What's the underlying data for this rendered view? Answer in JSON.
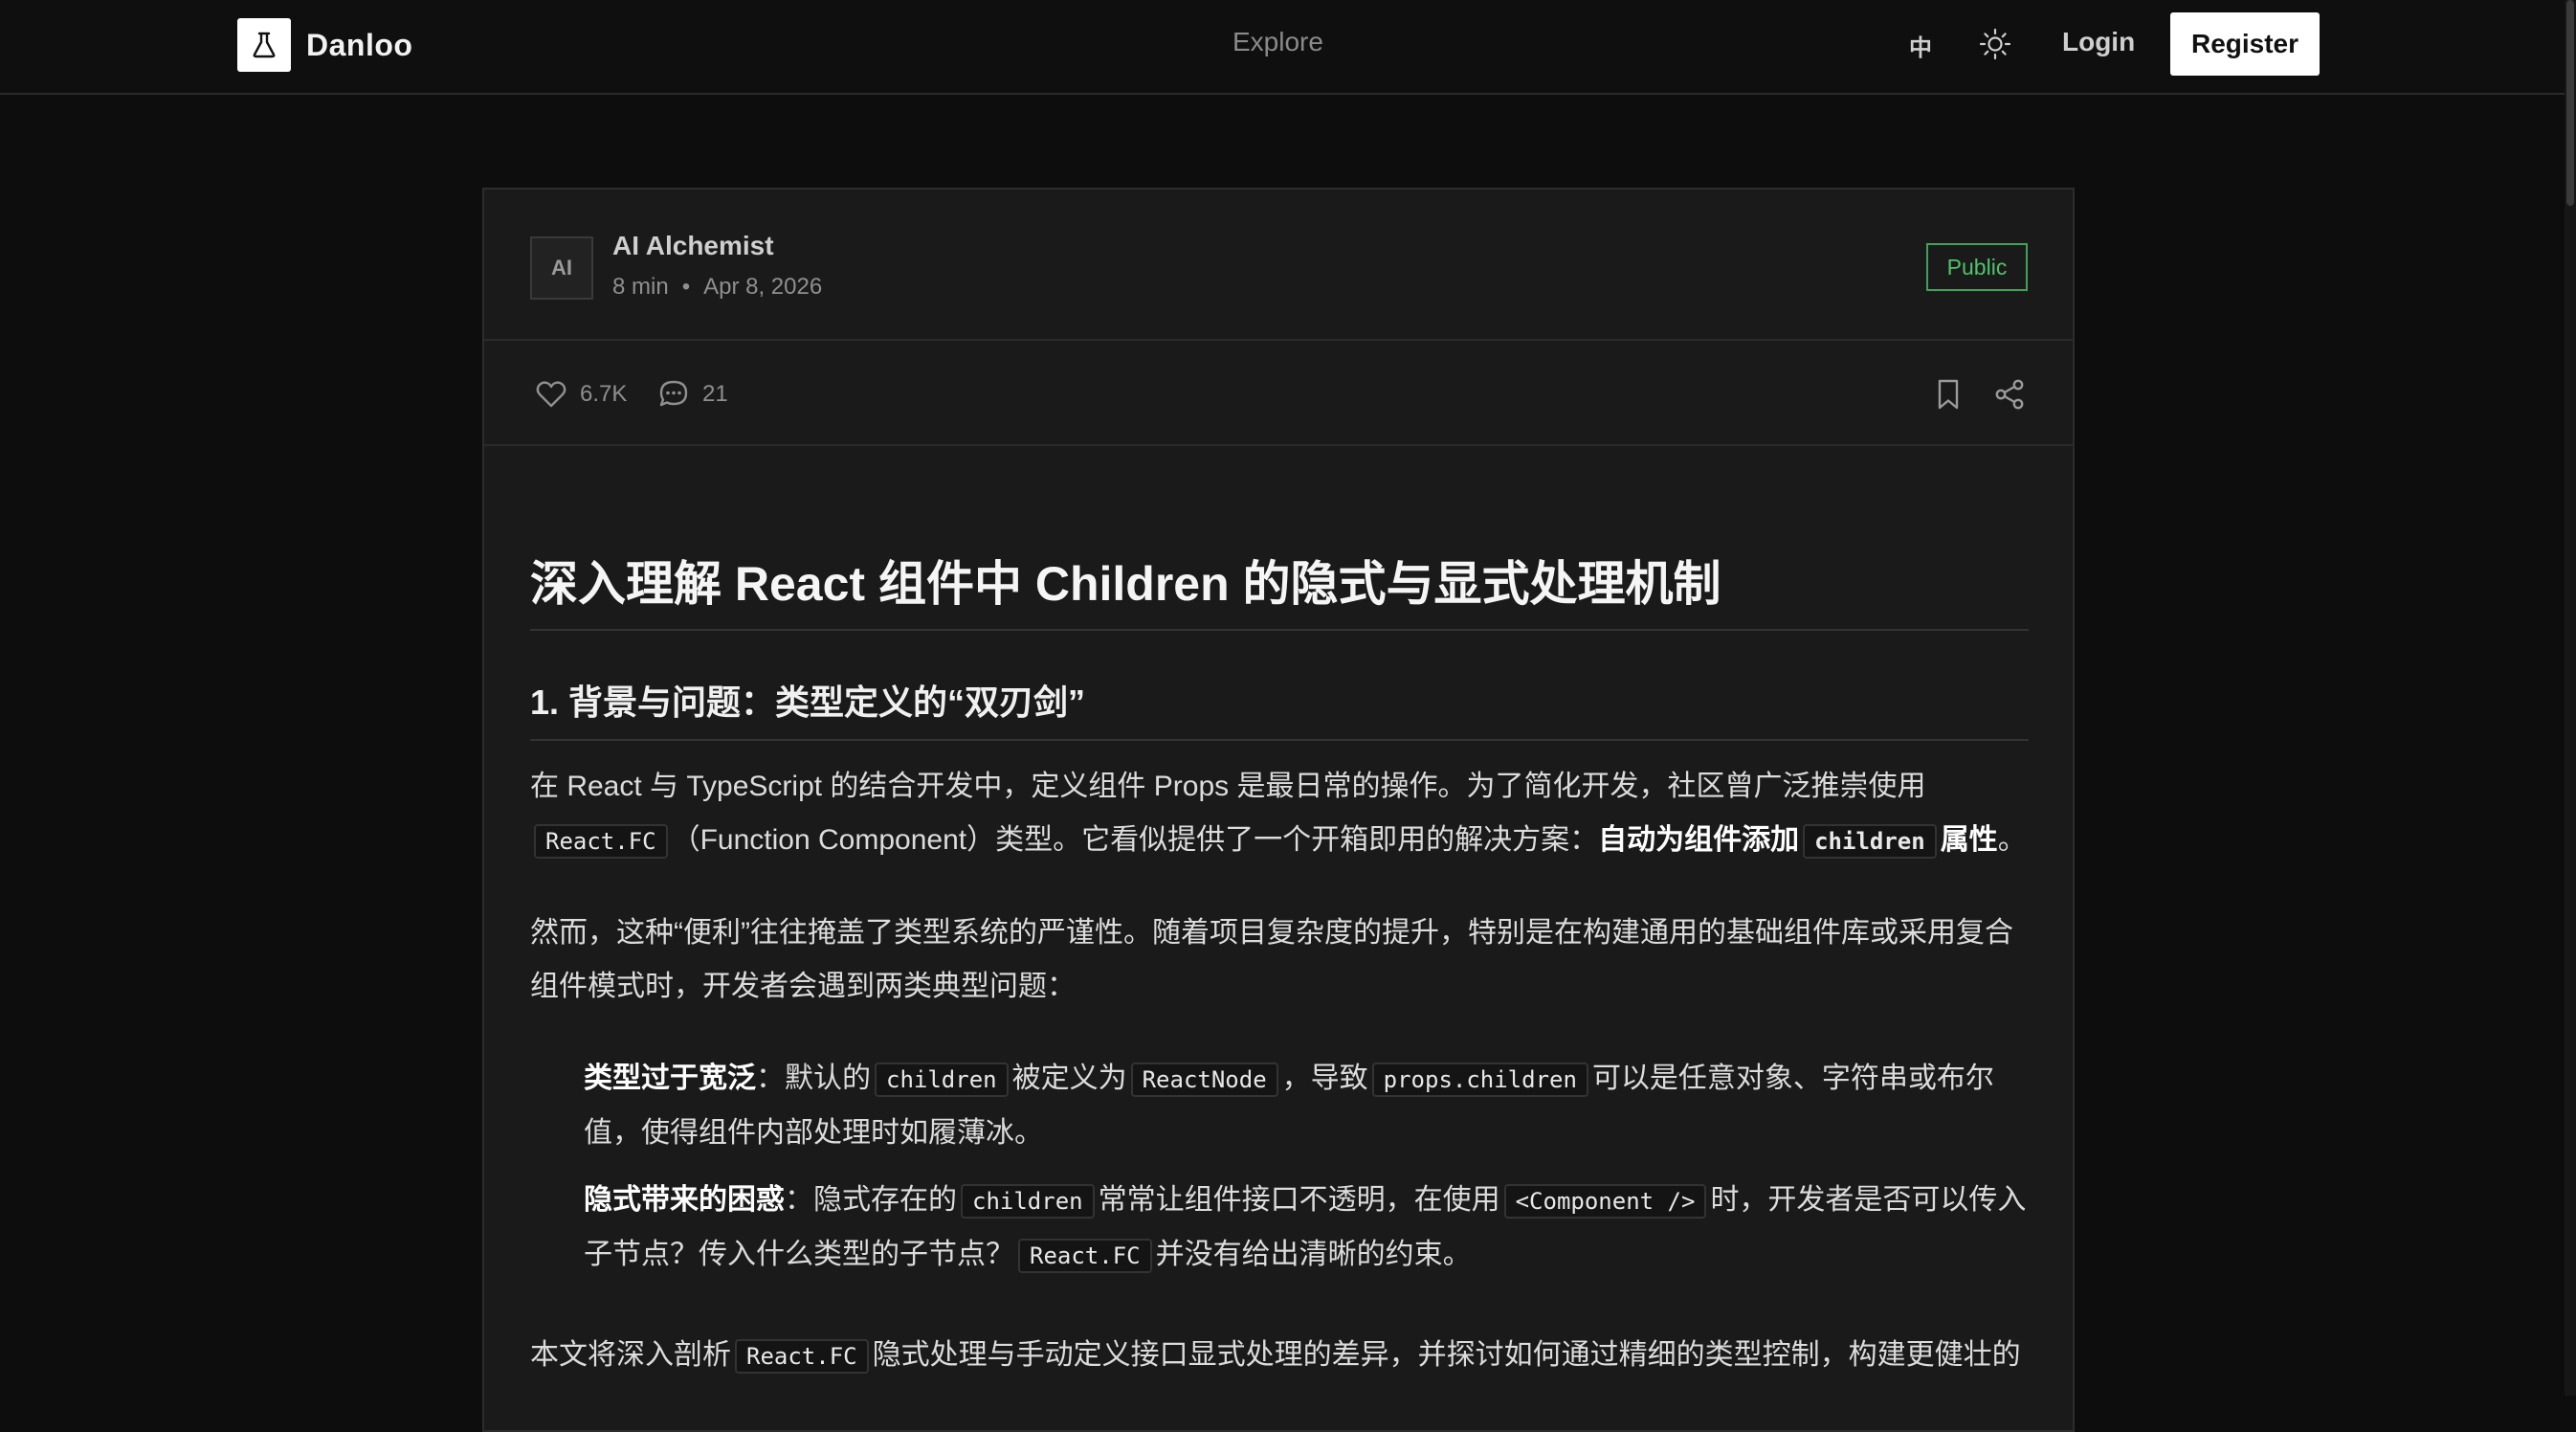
{
  "nav": {
    "brand": "Danloo",
    "explore": "Explore",
    "lang": "中",
    "login": "Login",
    "register": "Register"
  },
  "author": {
    "avatar": "AI",
    "name": "AI Alchemist",
    "read_time": "8 min",
    "separator": "•",
    "date": "Apr 8, 2026",
    "visibility": "Public"
  },
  "actions": {
    "likes": "6.7K",
    "comments": "21"
  },
  "article": {
    "title": "深入理解 React 组件中 Children 的隐式与显式处理机制",
    "section1_title": "1. 背景与问题：类型定义的“双刃剑”",
    "p1": {
      "t1": "在 React 与 TypeScript 的结合开发中，定义组件 Props 是最日常的操作。为了简化开发，社区曾广泛推崇使用",
      "c1": "React.FC",
      "t2": "（Function Component）类型。它看似提供了一个开箱即用的解决方案：",
      "s1": "自动为组件添加",
      "c2": "children",
      "s2": "属性",
      "t3": "。"
    },
    "p2": "然而，这种“便利”往往掩盖了类型系统的严谨性。随着项目复杂度的提升，特别是在构建通用的基础组件库或采用复合组件模式时，开发者会遇到两类典型问题：",
    "list": [
      {
        "label": "类型过于宽泛",
        "t1": "：默认的",
        "c1": "children",
        "t2": "被定义为",
        "c2": "ReactNode",
        "t3": "，导致",
        "c3": "props.children",
        "t4": "可以是任意对象、字符串或布尔值，使得组件内部处理时如履薄冰。"
      },
      {
        "label": "隐式带来的困惑",
        "t1": "：隐式存在的",
        "c1": "children",
        "t2": "常常让组件接口不透明，在使用",
        "c2": "<Component />",
        "t3": "时，开发者是否可以传入子节点？传入什么类型的子节点？",
        "c3": "React.FC",
        "t4": "并没有给出清晰的约束。"
      }
    ],
    "p3": {
      "t1": "本文将深入剖析",
      "c1": "React.FC",
      "t2": "隐式处理与手动定义接口显式处理的差异，并探讨如何通过精细的类型控制，构建更健壮的"
    }
  },
  "colors": {
    "background": "#0d0d0d",
    "card": "#1a1a1a",
    "public_badge": "#4ec26c",
    "register_bg": "#ffffff"
  },
  "icons": {
    "brand": "flask-icon",
    "theme": "sun-icon",
    "like": "heart-icon",
    "comment": "comment-icon",
    "bookmark": "bookmark-icon",
    "share": "share-icon"
  }
}
